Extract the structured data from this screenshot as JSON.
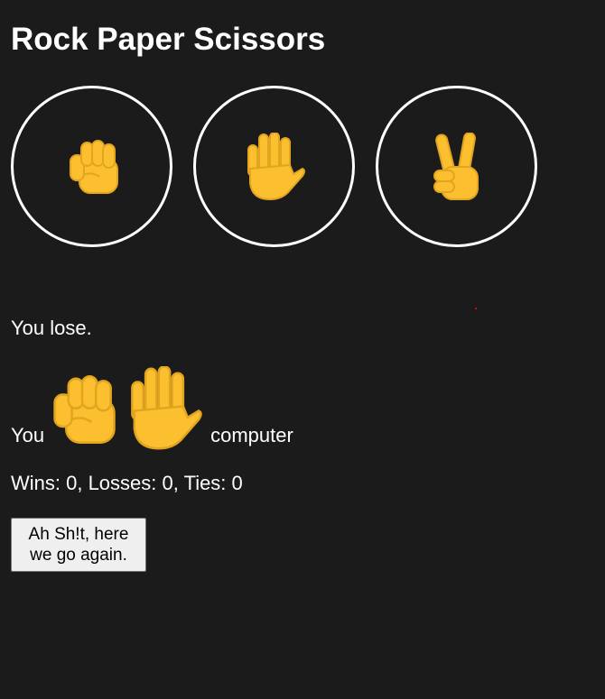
{
  "title": "Rock Paper Scissors",
  "choices": [
    {
      "name": "rock",
      "icon": "raised-fist-icon"
    },
    {
      "name": "paper",
      "icon": "raised-hand-icon"
    },
    {
      "name": "scissors",
      "icon": "victory-hand-icon"
    }
  ],
  "result": "You lose.",
  "match": {
    "player_label": "You",
    "player_choice": "rock",
    "computer_label": "computer",
    "computer_choice": "paper"
  },
  "score": {
    "text": "Wins: 0, Losses: 0, Ties: 0",
    "wins": 0,
    "losses": 0,
    "ties": 0
  },
  "again_button": "Ah Sh!t, here we go again.",
  "colors": {
    "background": "#1b1b1b",
    "text": "#ffffff",
    "emoji_skin": "#fbbf2f",
    "emoji_shade": "#e2a51f",
    "circle_border": "#ffffff",
    "button_bg": "#efefef"
  }
}
